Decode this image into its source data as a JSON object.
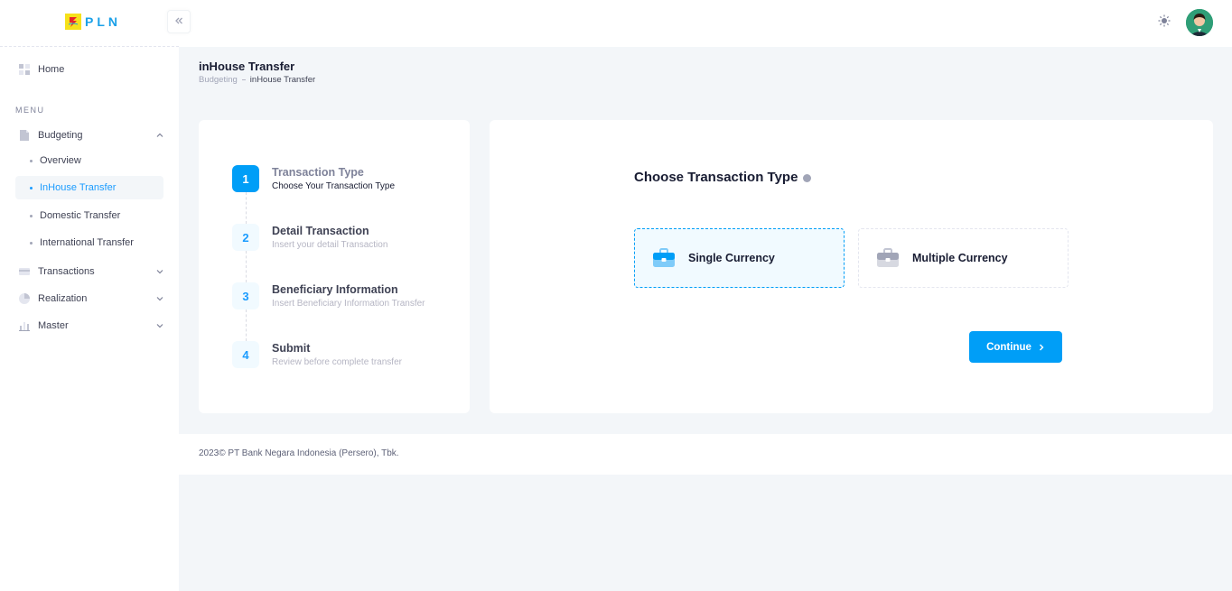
{
  "brand": {
    "name": "PLN",
    "mark_color": "#F6E11A",
    "text_color": "#1AA0E8"
  },
  "sidebar": {
    "home": {
      "label": "Home",
      "icon": "grid-icon"
    },
    "menu_label": "MENU",
    "budgeting": {
      "label": "Budgeting",
      "icon": "document-icon",
      "expanded": true,
      "items": [
        {
          "label": "Overview",
          "active": false
        },
        {
          "label": "InHouse Transfer",
          "active": true
        },
        {
          "label": "Domestic Transfer",
          "active": false
        },
        {
          "label": "International Transfer",
          "active": false
        }
      ]
    },
    "sections": [
      {
        "label": "Transactions",
        "icon": "card-icon"
      },
      {
        "label": "Realization",
        "icon": "pie-chart-icon"
      },
      {
        "label": "Master",
        "icon": "bar-chart-icon"
      }
    ]
  },
  "header": {
    "collapse_icon": "double-chevron-left-icon",
    "theme_icon": "sun-icon",
    "avatar_icon": "user-avatar"
  },
  "page": {
    "title": "inHouse Transfer",
    "breadcrumb": [
      "Budgeting",
      "inHouse Transfer"
    ]
  },
  "stepper": {
    "steps": [
      {
        "number": "1",
        "title": "Transaction Type",
        "description": "Choose Your Transaction Type",
        "current": true
      },
      {
        "number": "2",
        "title": "Detail Transaction",
        "description": "Insert your detail Transaction",
        "current": false
      },
      {
        "number": "3",
        "title": "Beneficiary Information",
        "description": "Insert Beneficiary Information Transfer",
        "current": false
      },
      {
        "number": "4",
        "title": "Submit",
        "description": "Review before complete transfer",
        "current": false
      }
    ]
  },
  "transaction_type": {
    "heading": "Choose Transaction Type",
    "options": [
      {
        "label": "Single Currency",
        "icon": "briefcase-icon",
        "selected": true
      },
      {
        "label": "Multiple Currency",
        "icon": "briefcase-icon",
        "selected": false
      }
    ],
    "continue_label": "Continue"
  },
  "footer": {
    "text": "2023© PT Bank Negara Indonesia (Persero), Tbk."
  },
  "colors": {
    "primary": "#009EF7",
    "primary_light": "#F1FAFF",
    "background": "#F3F6F9"
  }
}
